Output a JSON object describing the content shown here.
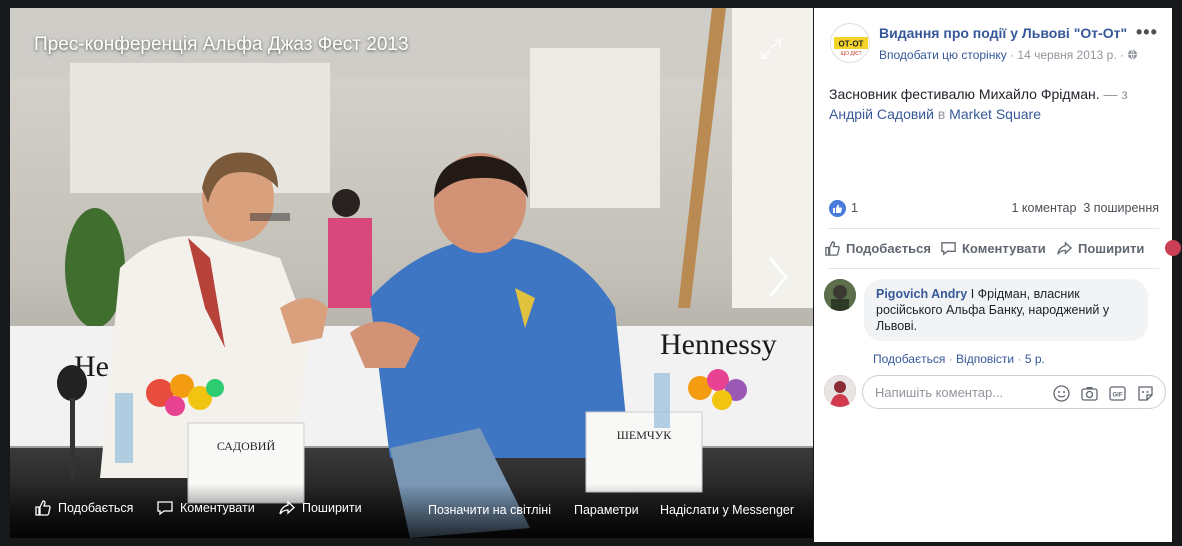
{
  "photo": {
    "title": "Прес-конференція Альфа Джаз Фест 2013",
    "banner_text": "Hennessy",
    "banner_text_left": "He",
    "name_card_left": "САДОВИЙ",
    "name_card_right": "ШЕМЧУК",
    "toolbar": {
      "like": "Подобається",
      "comment": "Коментувати",
      "share": "Поширити",
      "tag": "Позначити на світліні",
      "options": "Параметри",
      "messenger": "Надіслати у Messenger"
    }
  },
  "page": {
    "name": "Видання про події у Львові \"От-От\"",
    "logo_text": "ОТ-ОТ",
    "logo_sub": "ЩО ДІЄ?",
    "follow": "Вподобати цю сторінку",
    "sep": "·",
    "date": "14 червня 2013 р.",
    "sep2": "·",
    "globe_icon": "globe-icon"
  },
  "post": {
    "text": "Засновник фестивалю Михайло Фрідман.",
    "with_prefix": "— з",
    "tagged": "Андрій Садовий",
    "in_prefix": "в",
    "place": "Market Square"
  },
  "stats": {
    "likes": "1",
    "comments": "1 коментар",
    "shares": "3 поширення"
  },
  "actions": {
    "like": "Подобається",
    "comment": "Коментувати",
    "share": "Поширити"
  },
  "comment": {
    "author": "Pigovich Andry",
    "text": "І Фрідман, власник російського Альфа Банку, народжений у Львові.",
    "like": "Подобається",
    "dot1": "·",
    "reply": "Відповісти",
    "dot2": "·",
    "time": "5 р."
  },
  "composer": {
    "placeholder": "Напишіть коментар..."
  },
  "colors": {
    "link": "#365899",
    "like_blue": "#4a7cdc",
    "muted": "#90949c"
  }
}
